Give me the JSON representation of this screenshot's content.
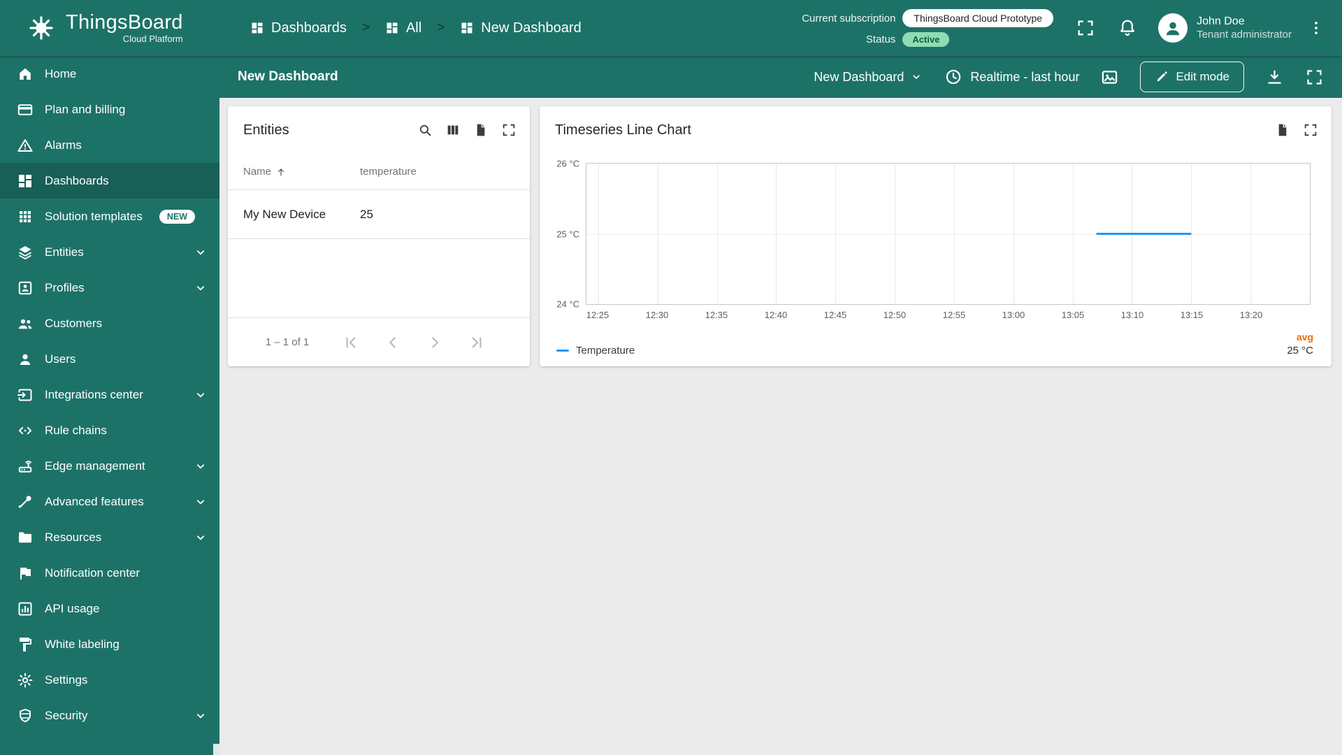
{
  "brand": {
    "name": "ThingsBoard",
    "subtitle": "Cloud Platform"
  },
  "header": {
    "breadcrumbs": [
      {
        "label": "Dashboards",
        "icon": "dashboards"
      },
      {
        "label": "All",
        "icon": "dashboards"
      },
      {
        "label": "New Dashboard",
        "icon": "dashboards"
      }
    ],
    "subscription_label": "Current subscription",
    "subscription_value": "ThingsBoard Cloud Prototype",
    "status_label": "Status",
    "status_value": "Active",
    "user": {
      "name": "John Doe",
      "role": "Tenant administrator"
    }
  },
  "toolbar": {
    "title": "New Dashboard",
    "state_select": "New Dashboard",
    "time_window": "Realtime - last hour",
    "edit_button": "Edit mode"
  },
  "sidebar": {
    "items": [
      {
        "label": "Home",
        "icon": "home"
      },
      {
        "label": "Plan and billing",
        "icon": "billing"
      },
      {
        "label": "Alarms",
        "icon": "alarms"
      },
      {
        "label": "Dashboards",
        "icon": "dashboards",
        "active": true
      },
      {
        "label": "Solution templates",
        "icon": "templates",
        "badge": "NEW"
      },
      {
        "label": "Entities",
        "icon": "entities",
        "expandable": true
      },
      {
        "label": "Profiles",
        "icon": "profiles",
        "expandable": true
      },
      {
        "label": "Customers",
        "icon": "customers"
      },
      {
        "label": "Users",
        "icon": "users"
      },
      {
        "label": "Integrations center",
        "icon": "integrations",
        "expandable": true
      },
      {
        "label": "Rule chains",
        "icon": "rule-chains"
      },
      {
        "label": "Edge management",
        "icon": "edge",
        "expandable": true
      },
      {
        "label": "Advanced features",
        "icon": "advanced",
        "expandable": true
      },
      {
        "label": "Resources",
        "icon": "resources",
        "expandable": true
      },
      {
        "label": "Notification center",
        "icon": "notification"
      },
      {
        "label": "API usage",
        "icon": "api"
      },
      {
        "label": "White labeling",
        "icon": "white-labeling"
      },
      {
        "label": "Settings",
        "icon": "settings"
      },
      {
        "label": "Security",
        "icon": "security",
        "expandable": true
      }
    ]
  },
  "entities_widget": {
    "title": "Entities",
    "columns": [
      "Name",
      "temperature"
    ],
    "sort_column": "Name",
    "sort_direction": "asc",
    "rows": [
      {
        "name": "My New Device",
        "temperature": "25"
      }
    ],
    "pagination": "1 – 1 of 1"
  },
  "chart_data": {
    "type": "line",
    "title": "Timeseries Line Chart",
    "x_domain": [
      "12:24",
      "13:25"
    ],
    "x_ticks": [
      "12:25",
      "12:30",
      "12:35",
      "12:40",
      "12:45",
      "12:50",
      "12:55",
      "13:00",
      "13:05",
      "13:10",
      "13:15",
      "13:20"
    ],
    "ylim": [
      24,
      26
    ],
    "y_ticks": [
      {
        "label": "26 °C",
        "value": 26
      },
      {
        "label": "25 °C",
        "value": 25
      },
      {
        "label": "24 °C",
        "value": 24
      }
    ],
    "grid": true,
    "legend_position": "bottom",
    "agg_label": "avg",
    "agg_color": "#ef6c00",
    "series": [
      {
        "name": "Temperature",
        "color": "#2196f3",
        "avg": "25 °C",
        "points": [
          {
            "x": "13:07",
            "y": 25
          },
          {
            "x": "13:15",
            "y": 25
          }
        ]
      }
    ]
  },
  "colors": {
    "primary": "#1d7268",
    "active_badge_bg": "#8fdcb4",
    "active_badge_text": "#0e5c38"
  }
}
